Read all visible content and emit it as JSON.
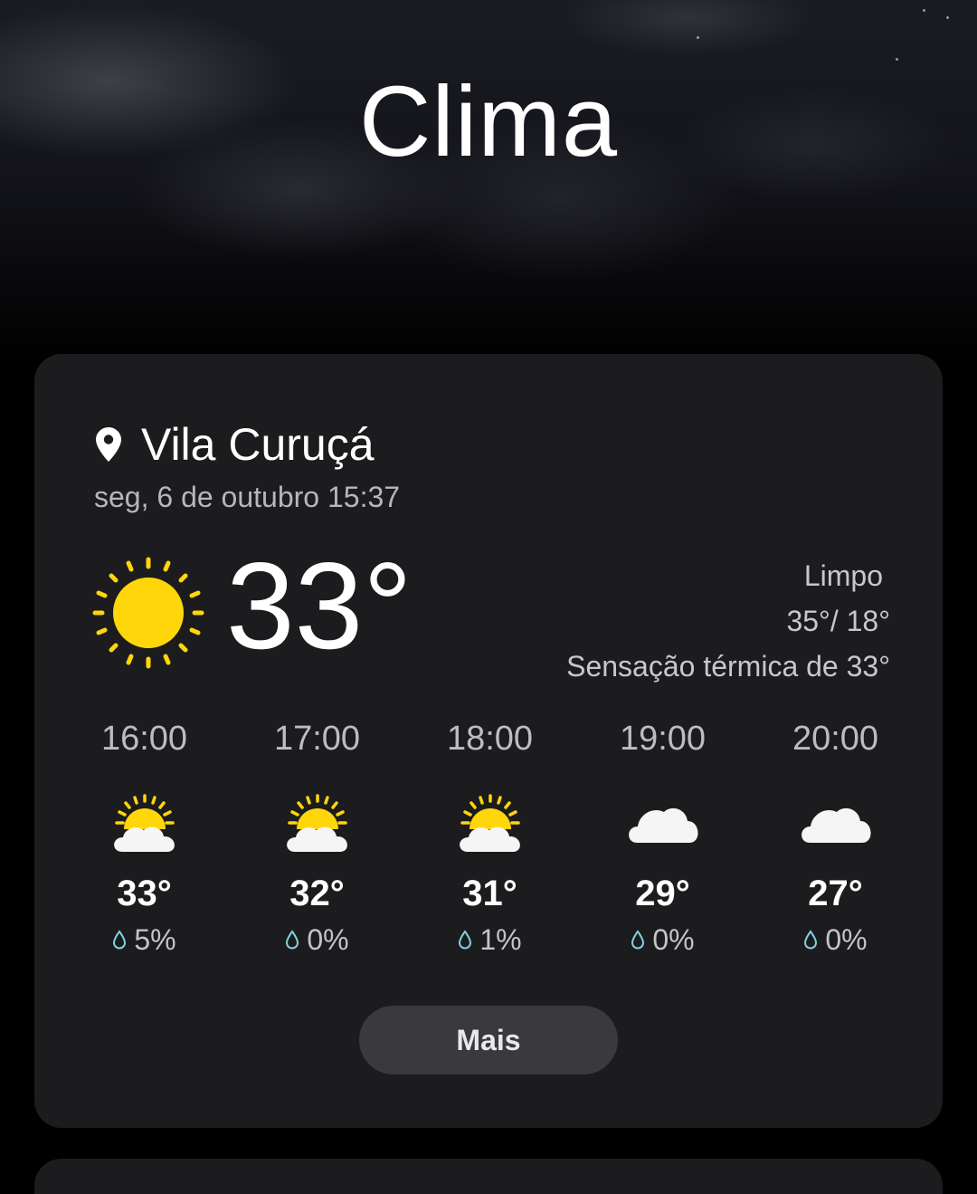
{
  "header": {
    "title": "Clima"
  },
  "current": {
    "location": "Vila Curuçá",
    "datetime": "seg, 6 de outubro 15:37",
    "temperature": "33°",
    "condition": "Limpo",
    "high_low": "35°/ 18°",
    "feels_like": "Sensação térmica de 33°",
    "icon": "sun-icon"
  },
  "hourly": [
    {
      "time": "16:00",
      "temp": "33°",
      "precip": "5%",
      "icon": "partly-cloudy-icon"
    },
    {
      "time": "17:00",
      "temp": "32°",
      "precip": "0%",
      "icon": "partly-cloudy-icon"
    },
    {
      "time": "18:00",
      "temp": "31°",
      "precip": "1%",
      "icon": "partly-cloudy-icon"
    },
    {
      "time": "19:00",
      "temp": "29°",
      "precip": "0%",
      "icon": "cloud-icon"
    },
    {
      "time": "20:00",
      "temp": "27°",
      "precip": "0%",
      "icon": "cloud-icon"
    }
  ],
  "more_button": {
    "label": "Mais"
  },
  "colors": {
    "background": "#000000",
    "card": "#1c1c1e",
    "sun": "#ffd60a",
    "button": "#3a3a3c",
    "drop": "#7fd1e0"
  }
}
